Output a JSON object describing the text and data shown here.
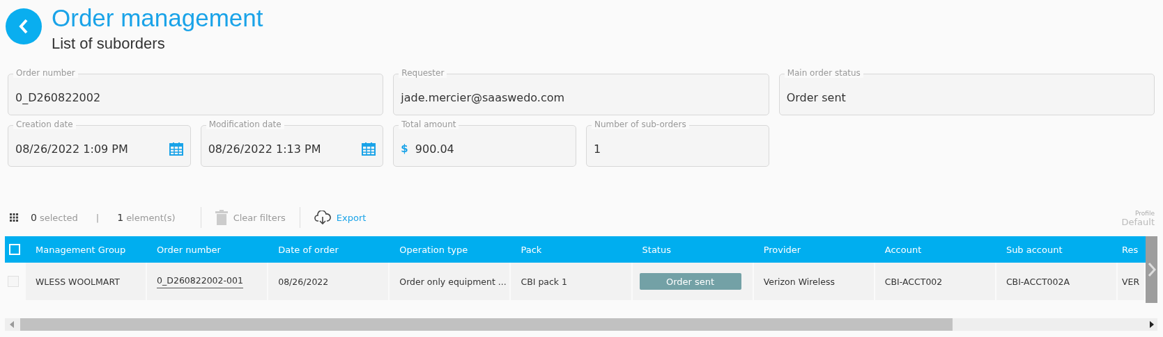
{
  "header": {
    "title": "Order management",
    "subtitle": "List of suborders"
  },
  "fields": [
    [
      {
        "label": "Order number",
        "value": "0_D260822002",
        "kind": "text"
      },
      {
        "label": "Requester",
        "value": "jade.mercier@saaswedo.com",
        "kind": "text"
      },
      {
        "label": "Main order status",
        "value": "Order sent",
        "kind": "text"
      }
    ],
    [
      {
        "label": "Creation date",
        "value": "08/26/2022 1:09 PM",
        "kind": "date"
      },
      {
        "label": "Modification date",
        "value": "08/26/2022 1:13 PM",
        "kind": "date"
      },
      {
        "label": "Total amount",
        "value": "900.04",
        "prefix": "$",
        "kind": "money"
      },
      {
        "label": "Number of sub-orders",
        "value": "1",
        "kind": "text"
      }
    ]
  ],
  "toolbar": {
    "selected_count": "0",
    "selected_label": "selected",
    "separator": "|",
    "element_count": "1",
    "element_label": "element(s)",
    "clear_filters": {
      "label": "Clear filters",
      "disabled": true
    },
    "export": {
      "label": "Export",
      "disabled": false
    },
    "profile_label": "Profile",
    "profile_value": "Default"
  },
  "table": {
    "select_all_checked": false,
    "columns": [
      "Management Group",
      "Order number",
      "Date of order",
      "Operation type",
      "Pack",
      "Status",
      "Provider",
      "Account",
      "Sub account",
      "Res"
    ],
    "rows": [
      {
        "checked": false,
        "cells": [
          {
            "text": "WLESS WOOLMART",
            "kind": "text"
          },
          {
            "text": "0_D260822002-001",
            "kind": "link"
          },
          {
            "text": "08/26/2022",
            "kind": "text"
          },
          {
            "text": "Order only equipment ...",
            "kind": "text"
          },
          {
            "text": "CBI pack 1",
            "kind": "text"
          },
          {
            "text": "Order sent",
            "kind": "status"
          },
          {
            "text": "Verizon Wireless",
            "kind": "text"
          },
          {
            "text": "CBI-ACCT002",
            "kind": "text"
          },
          {
            "text": "CBI-ACCT002A",
            "kind": "text"
          },
          {
            "text": "VER",
            "kind": "text"
          }
        ]
      }
    ]
  }
}
